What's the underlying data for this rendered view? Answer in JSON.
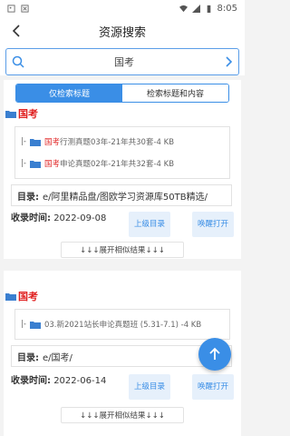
{
  "status_bar": {
    "time": "8:05"
  },
  "toolbar": {
    "title": "资源搜索"
  },
  "search": {
    "query": "国考"
  },
  "tabs": {
    "title_only": "仅检索标题",
    "title_and_content": "检索标题和内容"
  },
  "results": [
    {
      "title": "国考",
      "files": [
        {
          "prefix": "|- ",
          "highlight": "国考",
          "rest": "行测真题03年-21年共30套-4 KB"
        },
        {
          "prefix": "|- ",
          "highlight": "国考",
          "rest": "申论真题02年-21年共32套-4 KB"
        }
      ],
      "dir_label": "目录:",
      "dir_path": "e/阿里精品盘/图欧学习资源库50TB精选/",
      "time_label": "收录时间:",
      "time_value": "2022-09-08",
      "btn_parent": "上级目录",
      "btn_open": "唤醒打开",
      "expand": "↓↓↓展开相似结果↓↓↓"
    },
    {
      "title": "国考",
      "files": [
        {
          "prefix": "|- ",
          "highlight": "",
          "rest": "03.新2021站长申论真题班 (5.31-7.1) -4 KB"
        }
      ],
      "dir_label": "目录:",
      "dir_path": "e/国考/",
      "time_label": "收录时间:",
      "time_value": "2022-06-14",
      "btn_parent": "上级目录",
      "btn_open": "唤醒打开",
      "expand": "↓↓↓展开相似结果↓↓↓"
    }
  ],
  "colors": {
    "accent": "#3a8ee6",
    "highlight": "#e02020"
  }
}
